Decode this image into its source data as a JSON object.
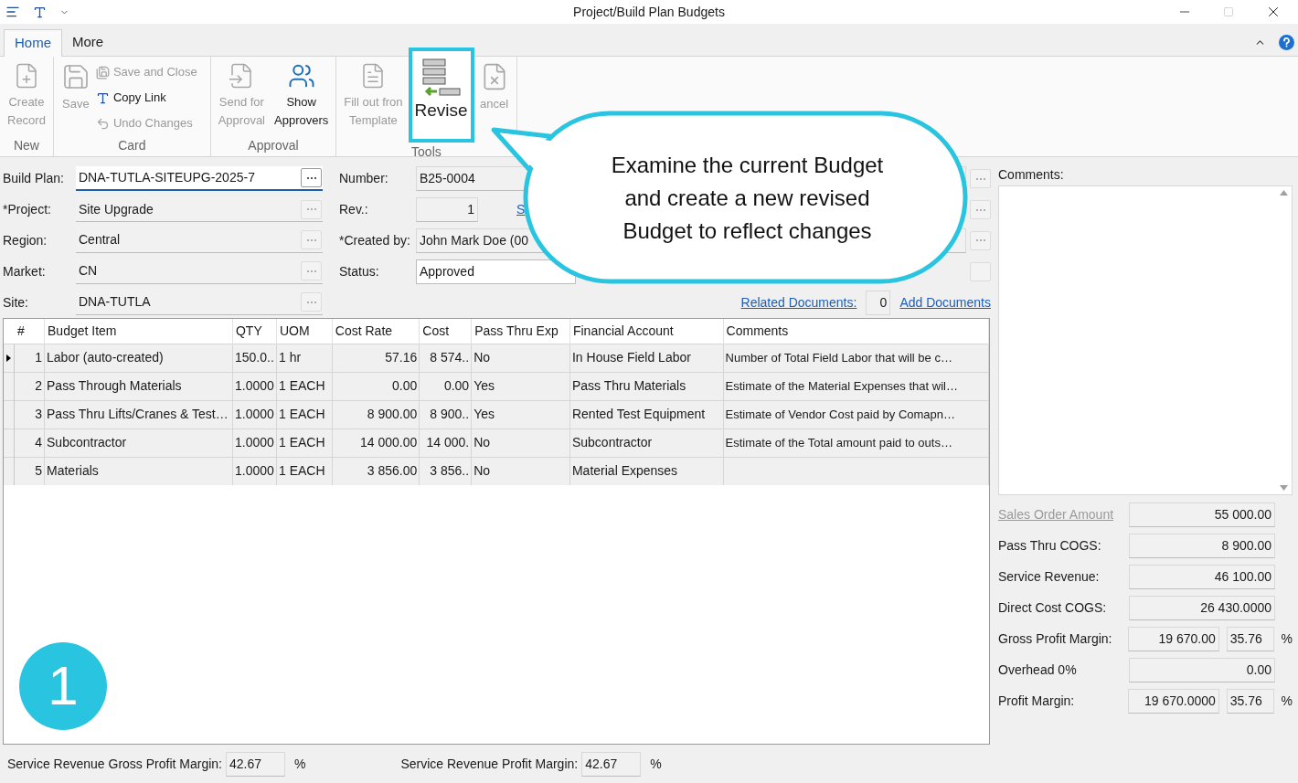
{
  "window": {
    "title": "Project/Build Plan Budgets"
  },
  "tabs": [
    {
      "label": "Home",
      "selected": true
    },
    {
      "label": "More",
      "selected": false
    }
  ],
  "ribbon_groups": [
    {
      "label": "New",
      "items": [
        {
          "kind": "large",
          "lines": [
            "Create",
            "Record"
          ],
          "disabled": true
        }
      ]
    },
    {
      "label": "Card",
      "items": [
        {
          "kind": "large",
          "lines": [
            "Save"
          ],
          "disabled": true
        },
        {
          "kind": "small",
          "lines": [
            "Save and Close"
          ],
          "disabled": true
        },
        {
          "kind": "small",
          "lines": [
            "Copy Link"
          ],
          "disabled": false
        },
        {
          "kind": "small",
          "lines": [
            "Undo Changes"
          ],
          "disabled": true
        }
      ]
    },
    {
      "label": "Approval",
      "items": [
        {
          "kind": "large",
          "lines": [
            "Send for",
            "Approval"
          ],
          "disabled": true
        },
        {
          "kind": "large",
          "lines": [
            "Show",
            "Approvers"
          ],
          "disabled": false
        }
      ]
    },
    {
      "label": "Tools",
      "items": [
        {
          "kind": "large",
          "lines": [
            "Fill out fron",
            "Template"
          ],
          "disabled": true
        },
        {
          "kind": "highlight",
          "lines": [
            "Revise"
          ],
          "disabled": false
        },
        {
          "kind": "large",
          "lines": [
            "ancel"
          ],
          "disabled": true
        }
      ]
    }
  ],
  "form_left": [
    {
      "label": "Build Plan:",
      "value": "DNA-TUTLA-SITEUPG-2025-7",
      "focused": true
    },
    {
      "label": "*Project:",
      "value": "Site Upgrade",
      "focused": false
    },
    {
      "label": "Region:",
      "value": "Central",
      "focused": false
    },
    {
      "label": "Market:",
      "value": "CN",
      "focused": false
    },
    {
      "label": "Site:",
      "value": "DNA-TUTLA",
      "focused": false
    }
  ],
  "form_mid": [
    {
      "kind": "wide",
      "label": "Number:",
      "value": "B25-0004"
    },
    {
      "kind": "short",
      "label": "Rev.:",
      "value": "1",
      "link": "S"
    },
    {
      "kind": "wide",
      "label": "*Created by:",
      "value": "John Mark Doe (00"
    },
    {
      "kind": "status",
      "label": "Status:",
      "value": "Approved"
    }
  ],
  "documents": {
    "link": "Related Documents:",
    "count": "0",
    "add_link": "Add Documents"
  },
  "table": {
    "columns": [
      "#",
      "Budget Item",
      "QTY",
      "UOM",
      "Cost Rate",
      "Cost",
      "Pass Thru Exp",
      "Financial Account",
      "Comments"
    ],
    "rows": [
      {
        "current": true,
        "cells": [
          "1",
          "Labor (auto-created)",
          "150.0..",
          "1 hr",
          "57.16",
          "8 574..",
          "No",
          "In House Field Labor",
          "Number of Total Field Labor that will be c…"
        ]
      },
      {
        "current": false,
        "cells": [
          "2",
          "Pass Through Materials",
          "1.0000",
          "1 EACH",
          "0.00",
          "0.00",
          "Yes",
          "Pass Thru Materials",
          "Estimate of the Material Expenses that wil…"
        ]
      },
      {
        "current": false,
        "cells": [
          "3",
          "Pass Thru Lifts/Cranes & Test…",
          "1.0000",
          "1 EACH",
          "8 900.00",
          "8 900..",
          "Yes",
          "Rented Test Equipment",
          "Estimate of Vendor Cost paid by Comapn…"
        ]
      },
      {
        "current": false,
        "cells": [
          "4",
          "Subcontractor",
          "1.0000",
          "1 EACH",
          "14 000.00",
          "14 000.",
          "No",
          "Subcontractor",
          "Estimate of the Total amount paid to outs…"
        ]
      },
      {
        "current": false,
        "cells": [
          "5",
          "Materials",
          "1.0000",
          "1 EACH",
          "3 856.00",
          "3 856..",
          "No",
          "Material Expenses",
          ""
        ]
      }
    ]
  },
  "comments": {
    "label": "Comments:"
  },
  "summary": [
    {
      "kind": "link",
      "label": "Sales Order Amount",
      "values": [
        "55 000.00"
      ]
    },
    {
      "kind": "plain",
      "label": "Pass Thru COGS:",
      "values": [
        "8 900.00"
      ]
    },
    {
      "kind": "plain",
      "label": "Service Revenue:",
      "values": [
        "46 100.00"
      ]
    },
    {
      "kind": "plain",
      "label": "Direct Cost COGS:",
      "values": [
        "26 430.0000"
      ]
    },
    {
      "kind": "percent",
      "label": "Gross Profit Margin:",
      "values": [
        "19 670.00",
        "35.76"
      ],
      "unit": "%"
    },
    {
      "kind": "plain",
      "label": "Overhead 0%",
      "values": [
        "0.00"
      ]
    },
    {
      "kind": "percent",
      "label": "Profit Margin:",
      "values": [
        "19 670.0000",
        "35.76"
      ],
      "unit": "%"
    }
  ],
  "footer": [
    {
      "label": "Service Revenue Gross Profit Margin:",
      "value": "42.67",
      "unit": "%"
    },
    {
      "label": "Service Revenue Profit Margin:",
      "value": "42.67",
      "unit": "%"
    }
  ],
  "callout": {
    "lines": [
      "Examine the current Budget",
      "and create a new revised",
      "Budget to reflect changes"
    ]
  },
  "step": {
    "number": "1"
  }
}
